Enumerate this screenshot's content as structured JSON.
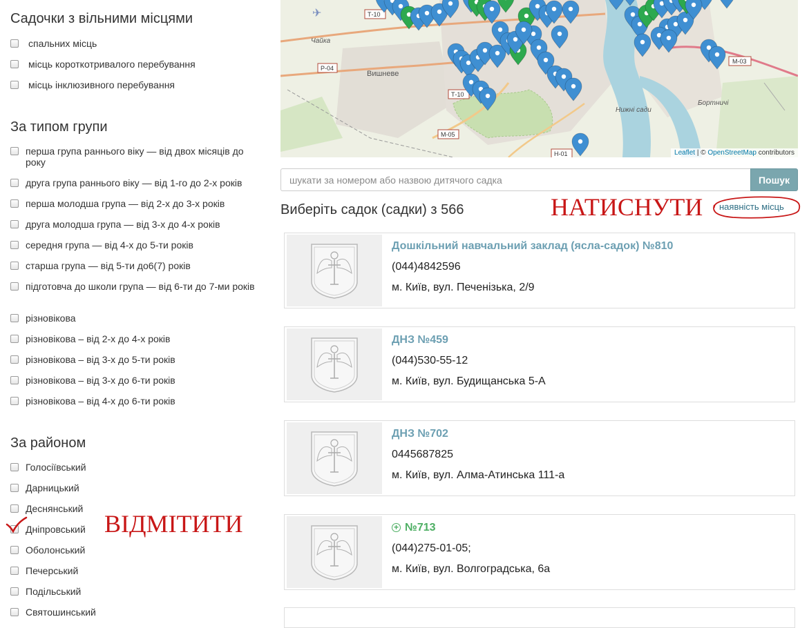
{
  "filters": {
    "free_places": {
      "heading": "Садочки з вільними місцями",
      "items": [
        "спальних місць",
        "місць короткотривалого перебування",
        "місць інклюзивного перебування"
      ]
    },
    "group_type": {
      "heading": "За типом групи",
      "items": [
        "перша група раннього віку — від двох місяців до року",
        "друга група раннього віку — від 1-го до 2-х років",
        "перша молодша група — від 2-х до 3-х років",
        "друга молодша група — від 3-х до 4-х років",
        "середня група — від 4-х до 5-ти років",
        "старша група — від 5-ти до6(7) років",
        "підготовча до школи група — від 6-ти до 7-ми років",
        "різновікова",
        "різновікова – від 2-х до 4-х років",
        "різновікова – від 3-х до 5-ти років",
        "різновікова – від 3-х до 6-ти років",
        "різновікова – від 4-х до 6-ти років"
      ]
    },
    "district": {
      "heading": "За районом",
      "items": [
        "Голосіївський",
        "Дарницький",
        "Деснянський",
        "Дніпровський",
        "Оболонський",
        "Печерський",
        "Подільський",
        "Святошинський"
      ]
    }
  },
  "annotations": {
    "check_note": "ВІДМІТИТИ",
    "click_note": "НАТИСНУТИ"
  },
  "map": {
    "places": [
      "Чайка",
      "Вишневе",
      "Нижні сади",
      "Бортничі"
    ],
    "roads": [
      "Т-10",
      "Р-04",
      "Т-10",
      "М-05",
      "Н-01",
      "М-03"
    ],
    "attribution": {
      "leaflet": "Leaflet",
      "separator": " | © ",
      "osm": "OpenStreetMap",
      "tail": " contributors"
    },
    "colors": {
      "marker_blue": "#3f8fd2",
      "marker_green": "#2da94f",
      "water": "#aad3df",
      "park": "#c8dfb0"
    }
  },
  "search": {
    "placeholder": "шукати за номером або назвою дитячого садка",
    "button": "Пошук"
  },
  "results": {
    "title": "Виберіть садок (садки) з 566",
    "sort_link": "наявність місць"
  },
  "kindergartens": [
    {
      "name": "Дошкільний навчальний заклад (ясла-садок) №810",
      "phone": "(044)4842596",
      "address": "м. Київ, вул. Печенізька, 2/9",
      "has_places": false
    },
    {
      "name": "ДНЗ №459",
      "phone": "(044)530-55-12",
      "address": "м. Київ, вул. Будищанська 5-А",
      "has_places": false
    },
    {
      "name": "ДНЗ №702",
      "phone": "0445687825",
      "address": "м. Київ, вул. Алма-Атинська 111-а",
      "has_places": false
    },
    {
      "name": "№713",
      "phone": "(044)275-01-05;",
      "address": "м. Київ, вул. Волгоградська, 6а",
      "has_places": true
    }
  ],
  "colors": {
    "link": "#6c9fb2",
    "green": "#4cae62",
    "button": "#7aa6ae",
    "annotation": "#c81717"
  }
}
